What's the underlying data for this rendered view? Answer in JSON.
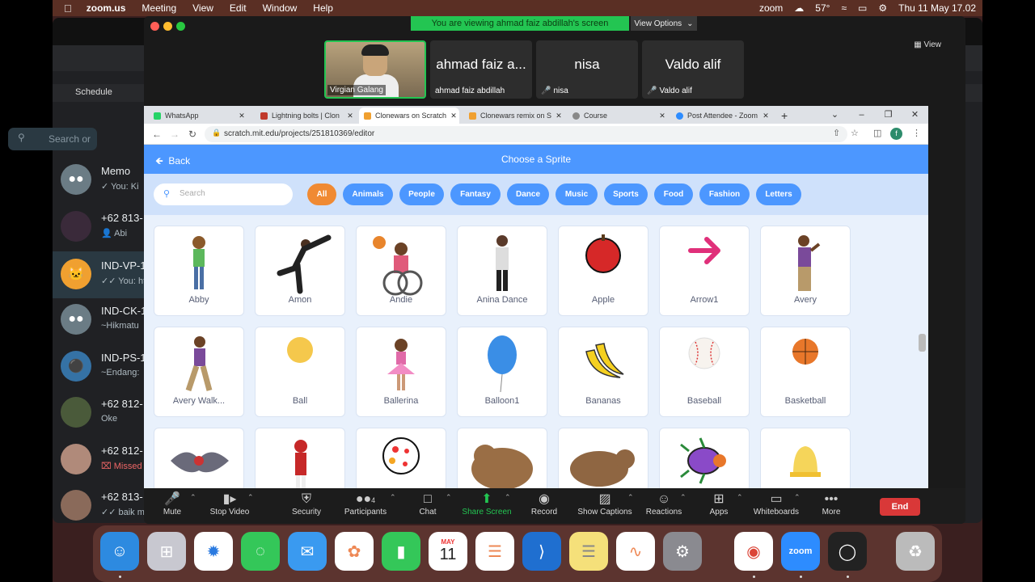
{
  "menubar": {
    "app": "zoom.us",
    "items": [
      "Meeting",
      "View",
      "Edit",
      "Window",
      "Help"
    ],
    "zoom_label": "zoom",
    "temperature": "57°",
    "datetime": "Thu 11 May  17.02"
  },
  "whatsapp": {
    "search_placeholder": "Search or",
    "chats": [
      {
        "name": "Memo",
        "preview": "✓ You: Ki"
      },
      {
        "name": "+62 813-",
        "preview": "👤 Abi"
      },
      {
        "name": "IND-VP-1",
        "preview": "✓✓ You: ht"
      },
      {
        "name": "IND-CK-1",
        "preview": "~Hikmatu"
      },
      {
        "name": "IND-PS-1",
        "preview": "~Endang:"
      },
      {
        "name": "+62 812-",
        "preview": "Oke"
      },
      {
        "name": "+62 812-",
        "preview": "⌧ Missed"
      },
      {
        "name": "+62 813-",
        "preview": "✓✓ baik m"
      }
    ],
    "bookmark": "Schedule"
  },
  "zoom": {
    "share_banner": "You are viewing ahmad faiz abdillah's screen",
    "view_options": "View Options",
    "view_label": "View",
    "participants": [
      {
        "big": "",
        "label": "Virgian Galang",
        "muted": false
      },
      {
        "big": "ahmad faiz a...",
        "label": "ahmad faiz abdillah",
        "muted": false
      },
      {
        "big": "nisa",
        "label": "nisa",
        "muted": true
      },
      {
        "big": "Valdo alif",
        "label": "Valdo alif",
        "muted": true
      }
    ],
    "toolbar": [
      {
        "label": "Mute",
        "icon": "mic"
      },
      {
        "label": "Stop Video",
        "icon": "camera"
      },
      {
        "label": "Security",
        "icon": "shield"
      },
      {
        "label": "Participants",
        "icon": "people",
        "count": "4"
      },
      {
        "label": "Chat",
        "icon": "chat"
      },
      {
        "label": "Share Screen",
        "icon": "share"
      },
      {
        "label": "Record",
        "icon": "record"
      },
      {
        "label": "Show Captions",
        "icon": "cc"
      },
      {
        "label": "Reactions",
        "icon": "smile"
      },
      {
        "label": "Apps",
        "icon": "apps"
      },
      {
        "label": "Whiteboards",
        "icon": "whiteboard"
      },
      {
        "label": "More",
        "icon": "more"
      }
    ],
    "end_label": "End"
  },
  "browser": {
    "tabs": [
      {
        "title": "WhatsApp",
        "color": "#25d366"
      },
      {
        "title": "Lightning bolts | Clon",
        "color": "#c0392b"
      },
      {
        "title": "Clonewars on Scratch",
        "color": "#f0a030"
      },
      {
        "title": "Clonewars remix on S",
        "color": "#f0a030"
      },
      {
        "title": "Course",
        "color": "#888888"
      },
      {
        "title": "Post Attendee - Zoom",
        "color": "#2d8cff"
      }
    ],
    "url": "scratch.mit.edu/projects/251810369/editor",
    "profile_initial": "f"
  },
  "scratch": {
    "back_label": "Back",
    "title": "Choose a Sprite",
    "search_placeholder": "Search",
    "categories": [
      "All",
      "Animals",
      "People",
      "Fantasy",
      "Dance",
      "Music",
      "Sports",
      "Food",
      "Fashion",
      "Letters"
    ],
    "active_category": "All",
    "sprites": [
      {
        "name": "Abby"
      },
      {
        "name": "Amon"
      },
      {
        "name": "Andie"
      },
      {
        "name": "Anina Dance"
      },
      {
        "name": "Apple"
      },
      {
        "name": "Arrow1"
      },
      {
        "name": "Avery"
      },
      {
        "name": "Avery Walk..."
      },
      {
        "name": "Ball"
      },
      {
        "name": "Ballerina"
      },
      {
        "name": "Balloon1"
      },
      {
        "name": "Bananas"
      },
      {
        "name": "Baseball"
      },
      {
        "name": "Basketball"
      },
      {
        "name": ""
      },
      {
        "name": ""
      },
      {
        "name": ""
      },
      {
        "name": ""
      },
      {
        "name": ""
      },
      {
        "name": ""
      },
      {
        "name": ""
      }
    ]
  },
  "dock": {
    "calendar_month": "MAY",
    "calendar_day": "11",
    "zoom_label": "zoom"
  }
}
